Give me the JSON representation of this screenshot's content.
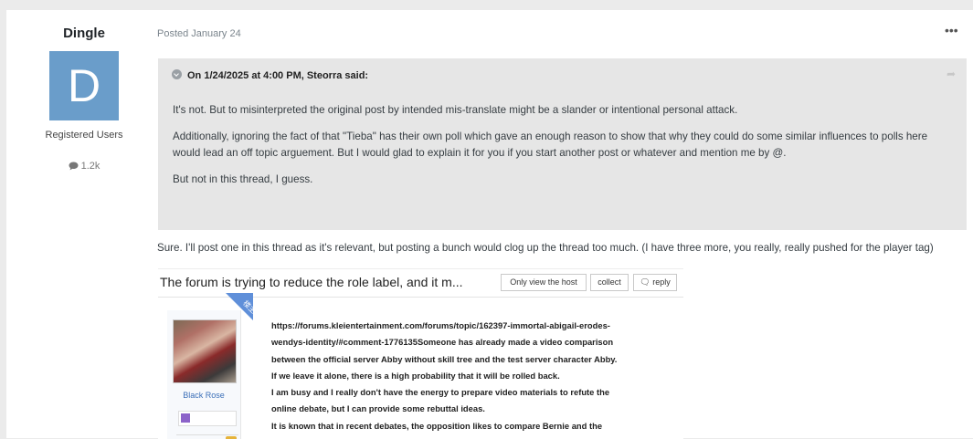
{
  "author": {
    "name": "Dingle",
    "avatar_letter": "D",
    "avatar_color": "#6a9dca",
    "group": "Registered Users",
    "reputation": "1.2k"
  },
  "post": {
    "posted": "Posted January 24",
    "menu_icon": "more-icon"
  },
  "quote": {
    "header": "On 1/24/2025 at 4:00 PM, Steorra said:",
    "paragraphs": [
      "It's not. But to misinterpreted the original post by intended mis-translate might be a slander or intentional personal attack.",
      "Additionally, ignoring the fact of that \"Tieba\" has their own poll which gave an enough reason to show that why they could do some similar influences to polls here would lead an off topic arguement. But I would glad to explain it for you if you start another post or whatever and mention me by @.",
      "But not in this thread, I guess."
    ]
  },
  "reply_text": "Sure. I'll post one in this thread as it's relevant, but posting a bunch would clog up the thread too much. (I have three more, you really, really pushed for the player tag)",
  "screenshot": {
    "title": "The forum is trying to reduce the role label, and it m...",
    "buttons": {
      "host": "Only view the host",
      "collect": "collect",
      "reply": "reply"
    },
    "corner_label": "楼主",
    "username": "Black Rose",
    "lines": [
      "https://forums.kleientertainment.com/forums/topic/162397-immortal-abigail-erodes-",
      "wendys-identity/#comment-1776135Someone has already made a video comparison",
      "between the official server Abby without skill tree and the test server character Abby.",
      "If we leave it alone, there is a high probability that it will be rolled back.",
      "I am busy and I really don't have the energy to prepare video materials to refute the",
      "online debate, but I can provide some rebuttal ideas.",
      "It is known that in recent debates, the opposition likes to compare Bernie and the"
    ]
  }
}
